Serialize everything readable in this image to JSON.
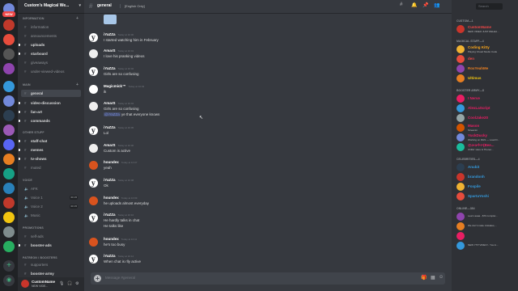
{
  "server": {
    "name": "Custom's Magical We...",
    "new_badge": "NEW"
  },
  "channels": {
    "categories": {
      "information": "INFORMATION",
      "main": "MAIN",
      "other_stuff": "OTHER STUFF",
      "voice": "VOICE",
      "promotions": "PROMOTIONS",
      "patreon": "PATREON / BOOSTERS"
    },
    "items": [
      {
        "label": "information"
      },
      {
        "label": "announcements"
      },
      {
        "label": "uploads"
      },
      {
        "label": "starboard"
      },
      {
        "label": "giveaways"
      },
      {
        "label": "under-viewed-videos"
      },
      {
        "label": "general"
      },
      {
        "label": "video-discussion"
      },
      {
        "label": "fan-art"
      },
      {
        "label": "commands"
      },
      {
        "label": "staff-chat"
      },
      {
        "label": "memes"
      },
      {
        "label": "tv-shows"
      },
      {
        "label": "muted"
      },
      {
        "label": "AFK"
      },
      {
        "label": "Voice 1",
        "count": "00 15"
      },
      {
        "label": "Voice 2",
        "count": "00 15"
      },
      {
        "label": "Music"
      },
      {
        "label": "self-ads"
      },
      {
        "label": "booster-ads"
      },
      {
        "label": "supporters"
      },
      {
        "label": "booster-army"
      }
    ]
  },
  "user_panel": {
    "name": "CustomName",
    "status": "NEW VIDE..."
  },
  "header": {
    "channel": "general",
    "topic": "[English Only]",
    "search_placeholder": "Search"
  },
  "messages": [
    {
      "author": "iYaZZa",
      "time": "Today at 10:00",
      "lines": [
        "I started watching him in February"
      ],
      "color": "#ffffff"
    },
    {
      "author": "AmarS",
      "time": "Today at 10:01",
      "lines": [
        "I love his pranking videos"
      ],
      "color": "#ffffff"
    },
    {
      "author": "iYaZZa",
      "time": "Today at 10:02",
      "lines": [
        "Girls are so confusing"
      ],
      "color": "#ffffff"
    },
    {
      "author": "Magicmick™",
      "time": "Today at 10:03",
      "lines": [
        "ik"
      ],
      "color": "#ffffff"
    },
    {
      "author": "AmarS",
      "time": "Today at 10:04",
      "lines": [
        "Girls are so confusing",
        "@iYaZZa ye that everyone knows"
      ],
      "color": "#ffffff"
    },
    {
      "author": "iYaZZa",
      "time": "Today at 10:05",
      "lines": [
        "Lol"
      ],
      "color": "#ffffff"
    },
    {
      "author": "AmarS",
      "time": "Today at 10:06",
      "lines": [
        "Custom is active"
      ],
      "color": "#ffffff"
    },
    {
      "author": "houndex",
      "time": "Today at 10:07",
      "lines": [
        "yeah"
      ],
      "color": "#ffffff"
    },
    {
      "author": "iYaZZa",
      "time": "Today at 10:08",
      "lines": [
        "Ok"
      ],
      "color": "#ffffff"
    },
    {
      "author": "houndex",
      "time": "Today at 10:09",
      "lines": [
        "he uploads almost everyday"
      ],
      "color": "#ffffff"
    },
    {
      "author": "iYaZZa",
      "time": "Today at 10:10",
      "lines": [
        "He hardly talks in chat",
        "He talks like"
      ],
      "color": "#ffffff"
    },
    {
      "author": "houndex",
      "time": "Today at 10:11",
      "lines": [
        "he's too busy"
      ],
      "color": "#ffffff"
    },
    {
      "author": "iYaZZa",
      "time": "Today at 10:12",
      "lines": [
        "When chat is rlly active"
      ],
      "color": "#ffffff"
    }
  ],
  "composer": {
    "placeholder": "Message #general"
  },
  "members": {
    "groups": [
      {
        "title": "CUSTOM—1",
        "members": [
          {
            "name": "CustomName",
            "activity": "NEW VIDEO JUST RELEA...",
            "color": "#f04747"
          }
        ]
      },
      {
        "title": "MAGICAL STAFF—4",
        "members": [
          {
            "name": "Coding Kitty",
            "activity": "Playing Visual Studio Code",
            "color": "#faa61a"
          },
          {
            "name": "den",
            "activity": "",
            "color": "#f04747"
          },
          {
            "name": "RoxYeahMe",
            "activity": "",
            "color": "#e67e22"
          },
          {
            "name": "Ultimus",
            "activity": "",
            "color": "#f1c40f"
          }
        ]
      },
      {
        "title": "BOOSTER ARMY—8",
        "members": [
          {
            "name": "I Nerve",
            "activity": "",
            "color": "#e91e63"
          },
          {
            "name": "AlexLaScript",
            "activity": "",
            "color": "#e91e63"
          },
          {
            "name": "CoolJake20",
            "activity": "",
            "color": "#e91e63"
          },
          {
            "name": "Mason",
            "activity": "Streamin",
            "color": "#e91e63"
          },
          {
            "name": "YuckDucky",
            "activity": "Working on RHS — Load D...",
            "color": "#e91e63"
          },
          {
            "name": "@a•a•f•r•(Bee...",
            "activity": "Chillin' Here & Thereo...",
            "color": "#e91e63"
          }
        ]
      },
      {
        "title": "CELEBRITIES—4",
        "members": [
          {
            "name": "Anubit",
            "activity": "",
            "color": "#3498db"
          },
          {
            "name": "brandonh",
            "activity": "",
            "color": "#3498db"
          },
          {
            "name": "Foxpile",
            "activity": "",
            "color": "#3498db"
          },
          {
            "name": "SpartaYoshi",
            "activity": "",
            "color": "#3498db"
          }
        ]
      },
      {
        "title": "ONLINE—384",
        "members": [
          {
            "name": "",
            "activity": "Learn aaaa - $70 complet...",
            "color": "#dcddde"
          },
          {
            "name": "",
            "activity": "We don't make mistakes,...",
            "color": "#dcddde"
          },
          {
            "name": "",
            "activity": "",
            "color": "#dcddde"
          },
          {
            "name": "",
            "activity": "NEW YTP VIDEO! - You A...",
            "color": "#dcddde"
          }
        ]
      }
    ]
  },
  "colors": {
    "accent": "#7289da",
    "danger": "#f04747",
    "booster": "#e91e63"
  }
}
